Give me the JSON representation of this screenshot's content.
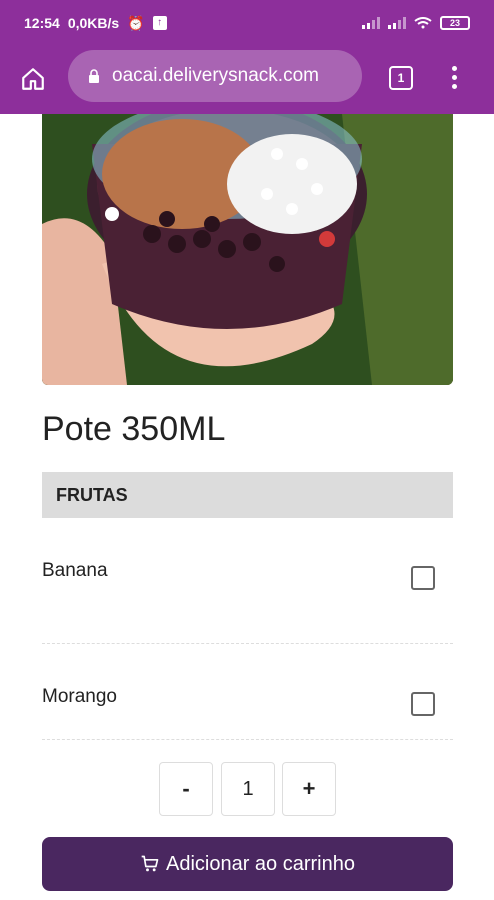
{
  "status_bar": {
    "time": "12:54",
    "speed": "0,0KB/s",
    "battery": "23"
  },
  "browser": {
    "url": "oacai.deliverysnack.com",
    "tab_count": "1"
  },
  "product": {
    "image_alt": "Pote de açaí com coberturas",
    "title": "Pote 350ML"
  },
  "section": {
    "title": "FRUTAS",
    "options": [
      {
        "label": "Banana",
        "checked": false
      },
      {
        "label": "Morango",
        "checked": false
      }
    ]
  },
  "quantity": {
    "minus": "-",
    "value": "1",
    "plus": "+"
  },
  "cart_button": {
    "label": "Adicionar ao carrinho"
  },
  "colors": {
    "header": "#8d2f9b",
    "url_box": "#a964b3",
    "button": "#4a2760",
    "section_bg": "#dcdcdc"
  }
}
